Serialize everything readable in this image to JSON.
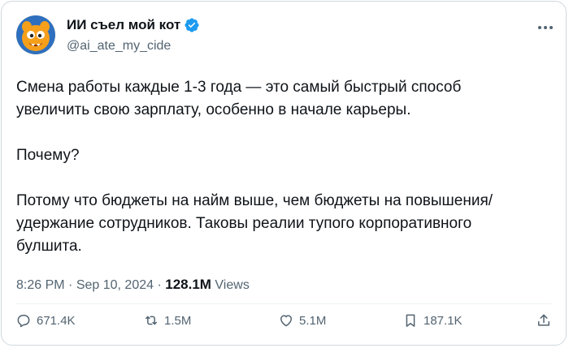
{
  "author": {
    "display_name": "ИИ съел мой кот",
    "handle": "@ai_ate_my_cide",
    "avatar_icon": "cartoon-creature-avatar",
    "verified_icon": "verified-badge-icon",
    "verified_color": "#1d9bf0"
  },
  "tweet": {
    "paragraphs": [
      [
        "Смена работы каждые 1-3 года — это самый быстрый способ",
        "увеличить свою зарплату, особенно в начале карьеры."
      ],
      [
        "Почему?"
      ],
      [
        "Потому что бюджеты на найм выше, чем бюджеты на повышения/",
        "удержание сотрудников. Таковы реалии тупого корпоративного",
        "булшита."
      ]
    ]
  },
  "meta": {
    "time": "8:26 PM",
    "date": "Sep 10, 2024",
    "views_count": "128.1M",
    "views_label": "Views",
    "sep": "·"
  },
  "actions": {
    "reply": {
      "icon": "reply-icon",
      "count": "671.4K"
    },
    "retweet": {
      "icon": "retweet-icon",
      "count": "1.5M"
    },
    "like": {
      "icon": "like-icon",
      "count": "5.1M"
    },
    "bookmark": {
      "icon": "bookmark-icon",
      "count": "187.1K"
    },
    "share": {
      "icon": "share-icon"
    }
  },
  "colors": {
    "text": "#0f1419",
    "secondary": "#536471",
    "border": "#cfd9de"
  }
}
